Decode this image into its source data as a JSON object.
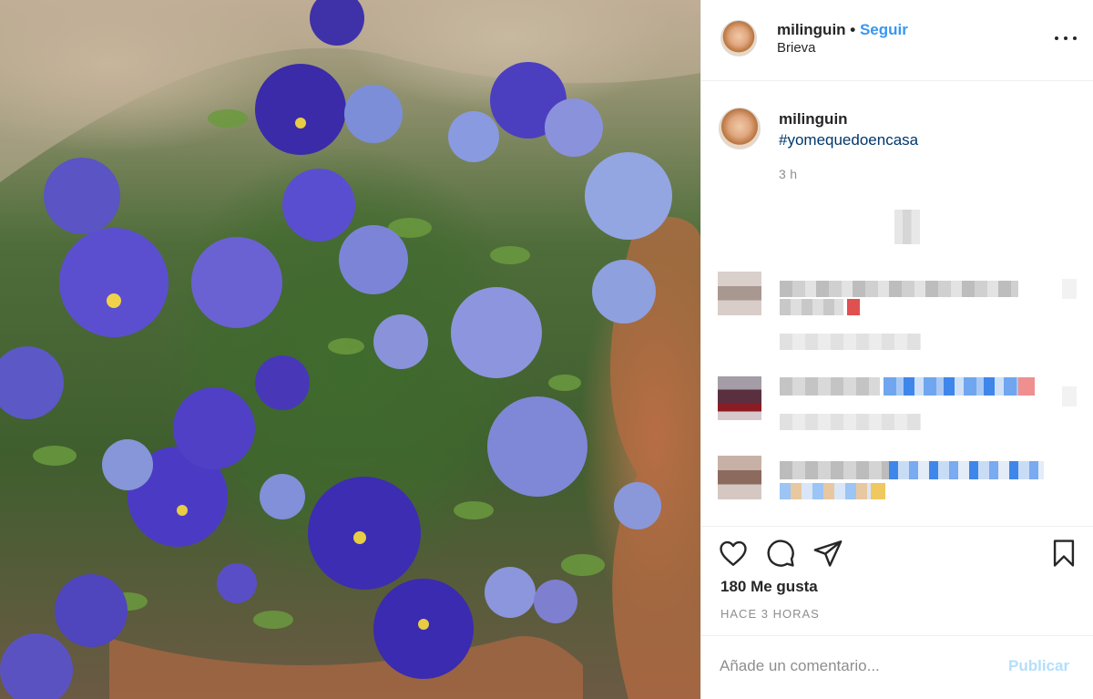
{
  "post": {
    "image_description_icon": "flower-photo",
    "header": {
      "username": "milinguin",
      "separator": "•",
      "follow_label": "Seguir",
      "location": "Brieva"
    },
    "caption": {
      "username": "milinguin",
      "hashtag": "#yomequedoencasa",
      "time": "3 h"
    },
    "actions": {
      "like_icon": "heart-icon",
      "comment_icon": "comment-icon",
      "share_icon": "paper-plane-icon",
      "save_icon": "bookmark-icon"
    },
    "likes": "180 Me gusta",
    "posted_ago": "HACE 3 HORAS",
    "comment": {
      "placeholder": "Añade un comentario...",
      "publish_label": "Publicar"
    }
  },
  "colors": {
    "accent": "#3897f0",
    "hashtag": "#00376b",
    "muted": "#8e8e8e",
    "publish_disabled": "#b2dffc"
  }
}
